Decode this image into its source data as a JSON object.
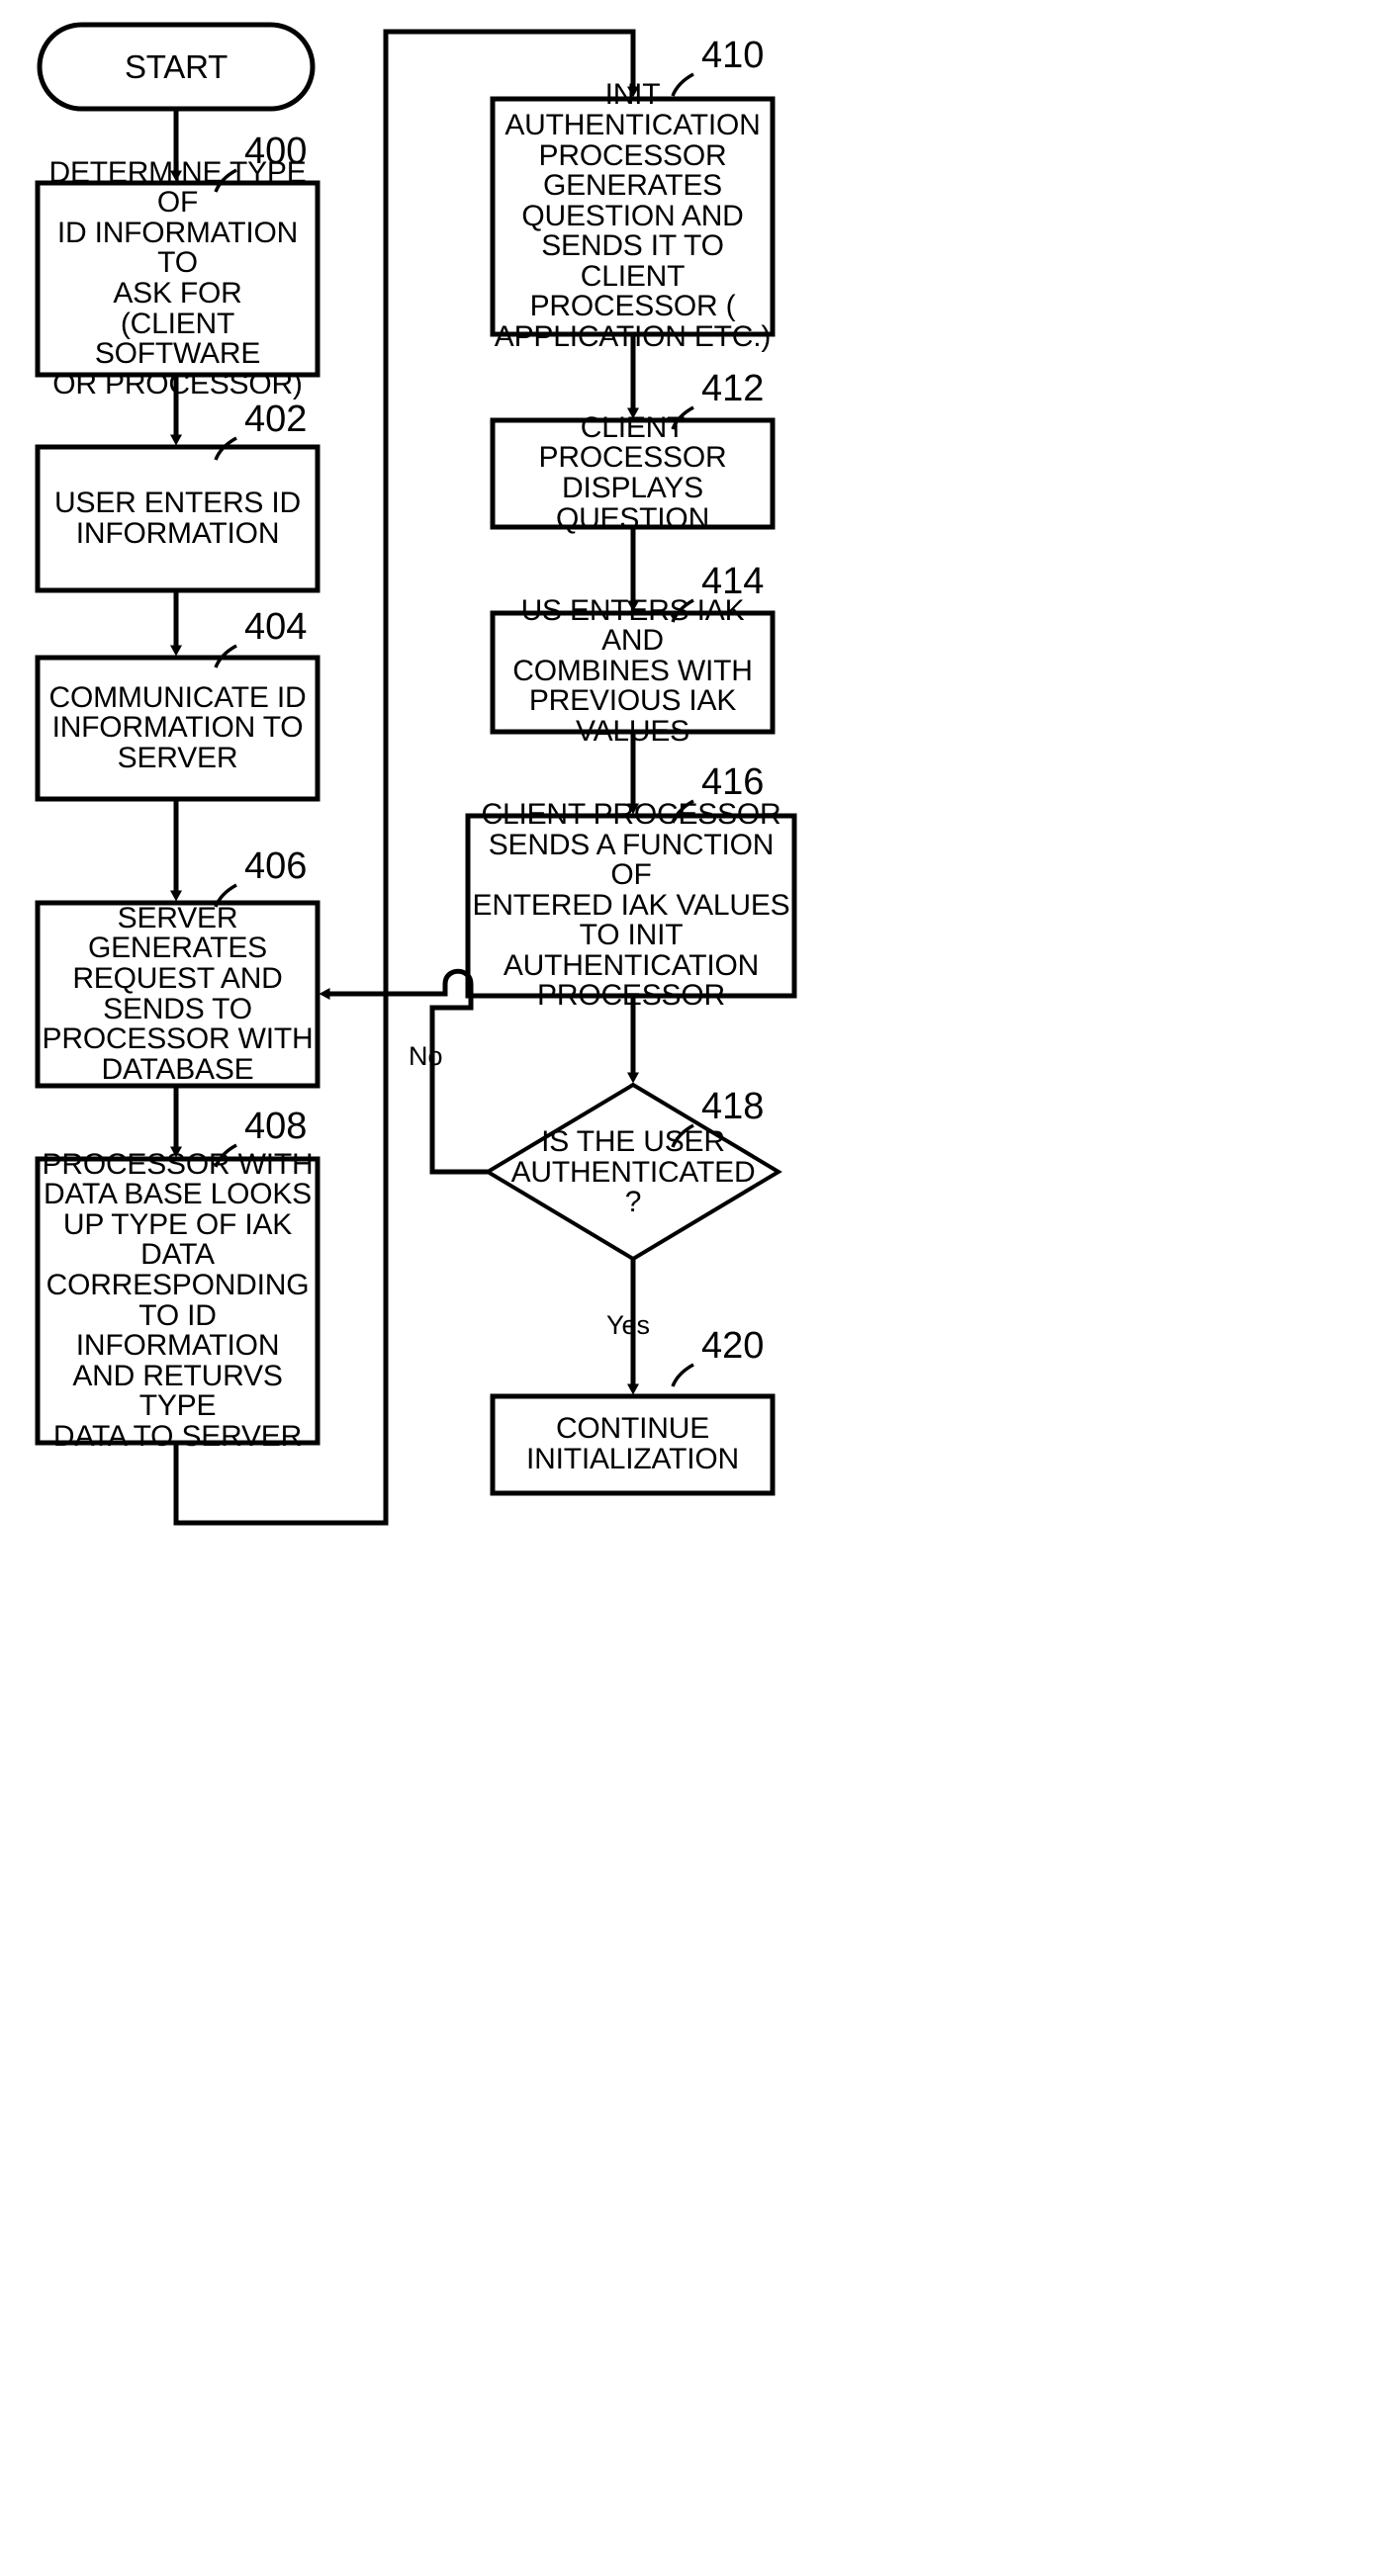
{
  "figure": {
    "kind": "patent-flowchart",
    "background": "#ffffff",
    "stroke": "#000000"
  },
  "nodes": {
    "start": {
      "ref": "",
      "label": "START",
      "shape": "terminator"
    },
    "n400": {
      "ref": "400",
      "label": "DETERMINE TYPE OF\nID INFORMATION TO\nASK FOR\n(CLIENT SOFTWARE\nOR PROCESSOR)",
      "shape": "process"
    },
    "n402": {
      "ref": "402",
      "label": "USER ENTERS ID\nINFORMATION",
      "shape": "process"
    },
    "n404": {
      "ref": "404",
      "label": "COMMUNICATE ID\nINFORMATION TO\nSERVER",
      "shape": "process"
    },
    "n406": {
      "ref": "406",
      "label": "SERVER\nGENERATES\nREQUEST AND\nSENDS TO\nPROCESSOR WITH\nDATABASE",
      "shape": "process"
    },
    "n408": {
      "ref": "408",
      "label": "PROCESSOR WITH\nDATA BASE LOOKS\nUP TYPE OF IAK\nDATA\nCORRESPONDING\nTO ID INFORMATION\nAND RETURVS TYPE\nDATA TO SERVER",
      "shape": "process"
    },
    "n410": {
      "ref": "410",
      "label": "INIT\nAUTHENTICATION\nPROCESSOR\nGENERATES\nQUESTION AND\nSENDS IT TO CLIENT\nPROCESSOR (\nAPPLICATION ETC.)",
      "shape": "process"
    },
    "n412": {
      "ref": "412",
      "label": "CLIENT PROCESSOR\nDISPLAYS QUESTION",
      "shape": "process"
    },
    "n414": {
      "ref": "414",
      "label": "US ENTERS IAK AND\nCOMBINES WITH\nPREVIOUS IAK\nVALUES",
      "shape": "process"
    },
    "n416": {
      "ref": "416",
      "label": "CLIENT PROCESSOR\nSENDS A FUNCTION OF\nENTERED IAK VALUES\nTO INIT\nAUTHENTICATION\nPROCESSOR",
      "shape": "process"
    },
    "n418": {
      "ref": "418",
      "label": "IS THE USER\nAUTHENTICATED\n?",
      "shape": "decision"
    },
    "n420": {
      "ref": "420",
      "label": "CONTINUE\nINITIALIZATION",
      "shape": "process"
    }
  },
  "edge_labels": {
    "no": "No",
    "yes": "Yes"
  }
}
